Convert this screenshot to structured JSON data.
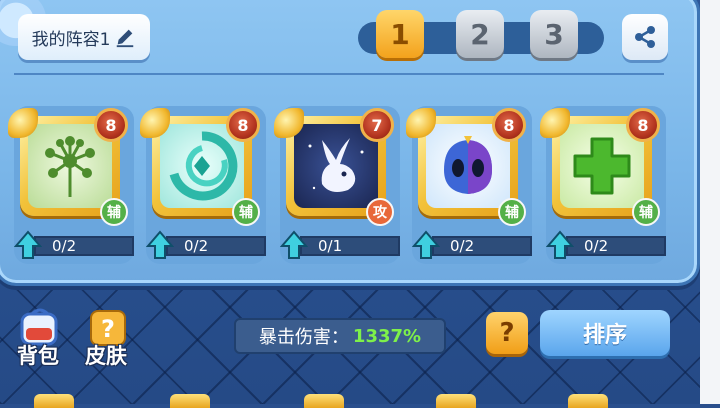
{
  "header": {
    "team_name": "我的阵容1",
    "tabs": [
      "1",
      "2",
      "3"
    ],
    "active_tab": "1"
  },
  "cards": [
    {
      "level": "8",
      "role": "辅",
      "progress": "0/2",
      "icon": "dandelion-icon",
      "art_color": "#cfe8b8",
      "role_color": "#54b048"
    },
    {
      "level": "8",
      "role": "辅",
      "progress": "0/2",
      "icon": "vortex-icon",
      "art_color": "#bff3ea",
      "role_color": "#54b048"
    },
    {
      "level": "7",
      "role": "攻",
      "progress": "0/1",
      "icon": "spirit-rabbit-icon",
      "art_color": "#22315e",
      "role_color": "#e8683a"
    },
    {
      "level": "8",
      "role": "辅",
      "progress": "0/2",
      "icon": "masked-head-icon",
      "art_color": "#dff1ff",
      "role_color": "#54b048"
    },
    {
      "level": "8",
      "role": "辅",
      "progress": "0/2",
      "icon": "green-cross-icon",
      "art_color": "#e7f6cf",
      "role_color": "#54b048"
    }
  ],
  "footer": {
    "bag_label": "背包",
    "skin_label": "皮肤",
    "crit_label": "暴击伤害：",
    "crit_value": "1337%",
    "help_label": "?",
    "sort_label": "排序"
  },
  "colors": {
    "panel": "#7ab6e9",
    "active_tab": "#f3a21c",
    "crit_value": "#7ef04a"
  }
}
